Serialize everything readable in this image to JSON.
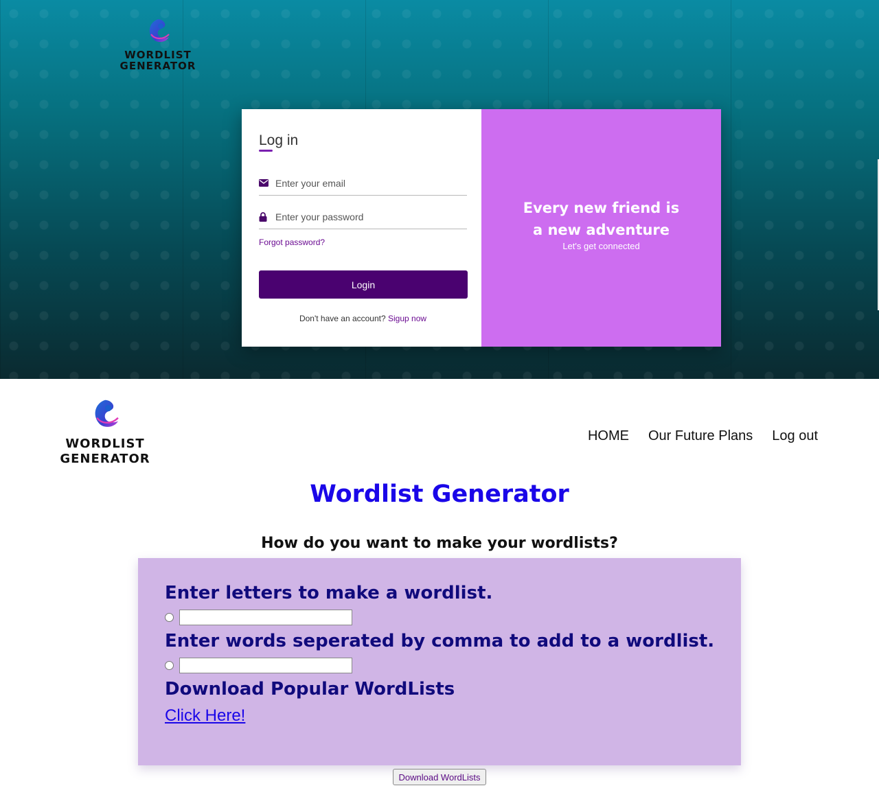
{
  "hero": {
    "logo": {
      "line1": "WORDLIST",
      "line2": "GENERATOR"
    },
    "login": {
      "title": "Log in",
      "email_placeholder": "Enter your email",
      "password_placeholder": "Enter your password",
      "forgot_label": "Forgot password?",
      "login_label": "Login",
      "signup_prompt": "Don't have an account?",
      "signup_link": "Sigup now"
    },
    "promo": {
      "title": "Every new friend is a new adventure",
      "subtitle": "Let's get connected"
    }
  },
  "header": {
    "logo": {
      "line1": "WORDLIST",
      "line2": "GENERATOR"
    },
    "nav": [
      {
        "label": "HOME"
      },
      {
        "label": "Our Future Plans"
      },
      {
        "label": "Log out"
      }
    ]
  },
  "main": {
    "title": "Wordlist Generator",
    "question": "How do you want to make your wordlists?",
    "option_letters": "Enter letters to make a wordlist.",
    "option_words": "Enter words seperated by comma to add to a wordlist.",
    "option_download": "Download Popular WordLists",
    "click_here": "Click Here!",
    "download_button": "Download WordLists"
  },
  "colors": {
    "brand_purple": "#4a0270",
    "promo_bg": "#cd6df0",
    "title_blue": "#1a06e8",
    "options_bg": "#d0b5e6",
    "heading_navy": "#100a7c"
  },
  "icons": [
    "envelope-icon",
    "lock-icon",
    "logo-icon"
  ]
}
